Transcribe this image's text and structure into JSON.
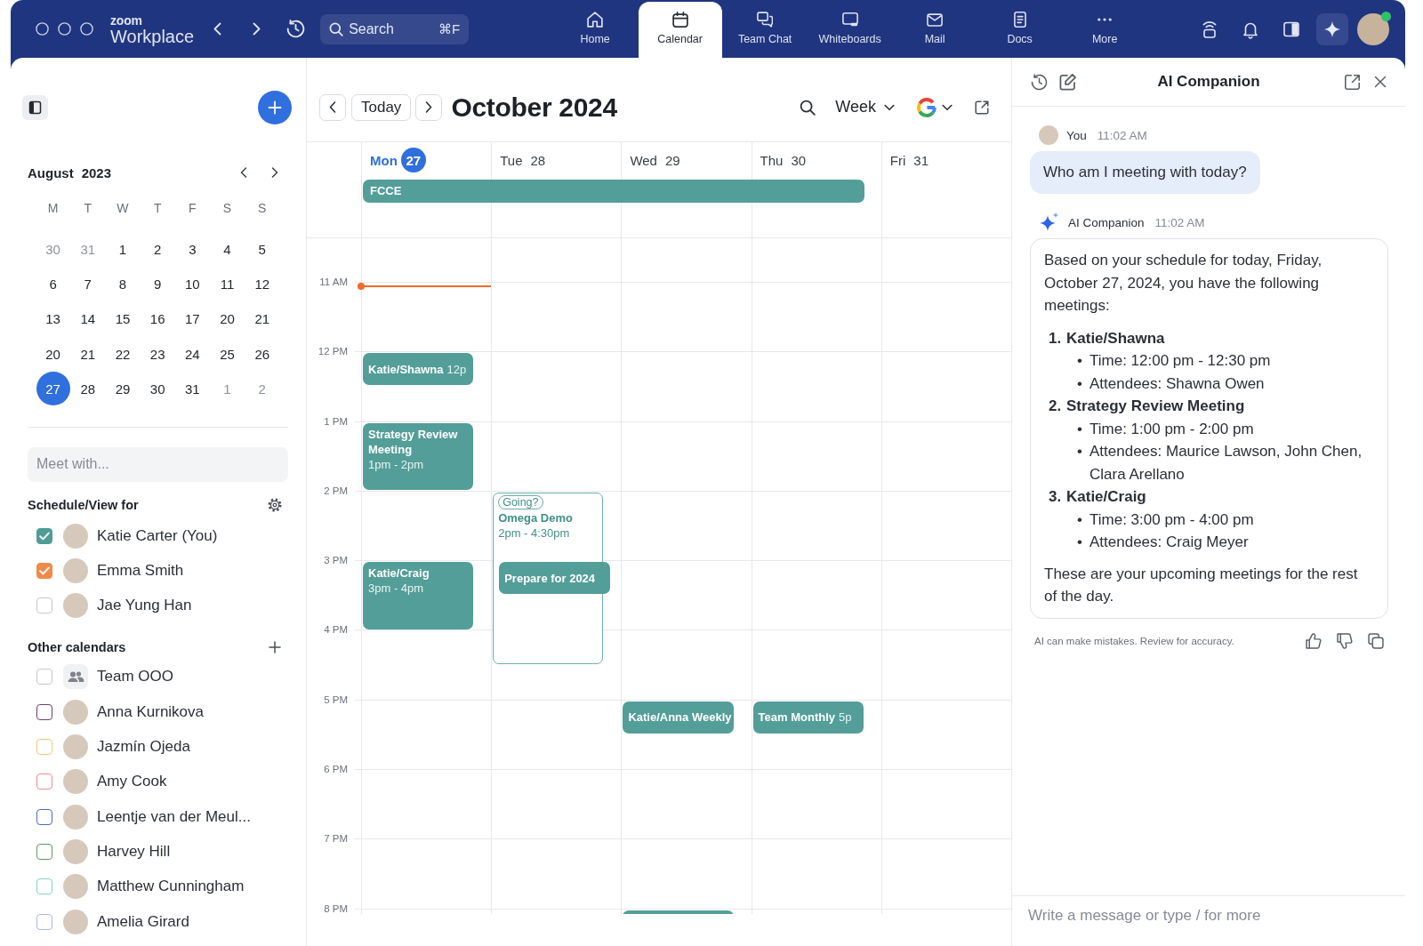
{
  "top_bar": {
    "logo_small": "zoom",
    "logo": "Workplace",
    "search": {
      "placeholder": "Search",
      "shortcut": "⌘F"
    },
    "nav": [
      {
        "label": "Home",
        "selected": false
      },
      {
        "label": "Calendar",
        "selected": true
      },
      {
        "label": "Team Chat",
        "selected": false
      },
      {
        "label": "Whiteboards",
        "selected": false
      },
      {
        "label": "Mail",
        "selected": false
      },
      {
        "label": "Docs",
        "selected": false
      },
      {
        "label": "More",
        "selected": false
      }
    ],
    "actions": [
      {
        "selected": false
      },
      {
        "selected": false
      },
      {
        "selected": false
      },
      {
        "selected": true
      }
    ],
    "user": {
      "online": true
    }
  },
  "sidebar": {
    "mini_calendar": {
      "month": "August",
      "year": "2023",
      "weekdays": [
        "M",
        "T",
        "W",
        "T",
        "F",
        "S",
        "S"
      ],
      "weeks": [
        [
          {
            "day": "30",
            "in_month": false,
            "selected": false
          },
          {
            "day": "31",
            "in_month": false,
            "selected": false
          },
          {
            "day": "1",
            "in_month": true,
            "selected": false
          },
          {
            "day": "2",
            "in_month": true,
            "selected": false
          },
          {
            "day": "3",
            "in_month": true,
            "selected": false
          },
          {
            "day": "4",
            "in_month": true,
            "selected": false
          },
          {
            "day": "5",
            "in_month": true,
            "selected": false
          }
        ],
        [
          {
            "day": "6",
            "in_month": true,
            "selected": false
          },
          {
            "day": "7",
            "in_month": true,
            "selected": false
          },
          {
            "day": "8",
            "in_month": true,
            "selected": false
          },
          {
            "day": "9",
            "in_month": true,
            "selected": false
          },
          {
            "day": "10",
            "in_month": true,
            "selected": false
          },
          {
            "day": "11",
            "in_month": true,
            "selected": false
          },
          {
            "day": "12",
            "in_month": true,
            "selected": false
          }
        ],
        [
          {
            "day": "13",
            "in_month": true,
            "selected": false
          },
          {
            "day": "14",
            "in_month": true,
            "selected": false
          },
          {
            "day": "15",
            "in_month": true,
            "selected": false
          },
          {
            "day": "16",
            "in_month": true,
            "selected": false
          },
          {
            "day": "17",
            "in_month": true,
            "selected": false
          },
          {
            "day": "20",
            "in_month": true,
            "selected": false
          },
          {
            "day": "21",
            "in_month": true,
            "selected": false
          }
        ],
        [
          {
            "day": "20",
            "in_month": true,
            "selected": false
          },
          {
            "day": "21",
            "in_month": true,
            "selected": false
          },
          {
            "day": "22",
            "in_month": true,
            "selected": false
          },
          {
            "day": "23",
            "in_month": true,
            "selected": false
          },
          {
            "day": "24",
            "in_month": true,
            "selected": false
          },
          {
            "day": "25",
            "in_month": true,
            "selected": false
          },
          {
            "day": "26",
            "in_month": true,
            "selected": false
          }
        ],
        [
          {
            "day": "27",
            "in_month": true,
            "selected": true
          },
          {
            "day": "28",
            "in_month": true,
            "selected": false
          },
          {
            "day": "29",
            "in_month": true,
            "selected": false
          },
          {
            "day": "30",
            "in_month": true,
            "selected": false
          },
          {
            "day": "31",
            "in_month": true,
            "selected": false
          },
          {
            "day": "1",
            "in_month": false,
            "selected": false
          },
          {
            "day": "2",
            "in_month": false,
            "selected": false
          }
        ]
      ]
    },
    "meet_with": {
      "placeholder": "Meet with..."
    },
    "schedule": {
      "title": "Schedule/View for",
      "people": [
        {
          "name": "Katie Carter (You)",
          "kind": "person",
          "checked": true,
          "color": "#4f9c96"
        },
        {
          "name": "Emma Smith",
          "kind": "person",
          "checked": true,
          "color": "#f08a4b"
        },
        {
          "name": "Jae Yung Han",
          "kind": "person",
          "checked": false,
          "color": "#c4c8cf"
        }
      ]
    },
    "other_calendars": {
      "title": "Other calendars",
      "items": [
        {
          "name": "Team OOO",
          "kind": "group",
          "checked": false,
          "color": "#c4c8cf"
        },
        {
          "name": "Anna Kurnikova",
          "kind": "person",
          "checked": false,
          "color": "#6e3f6e"
        },
        {
          "name": "Jazmín Ojeda",
          "kind": "person",
          "checked": false,
          "color": "#f4c87a"
        },
        {
          "name": "Amy Cook",
          "kind": "person",
          "checked": false,
          "color": "#e88e8e"
        },
        {
          "name": "Leentje van der Meul...",
          "kind": "person",
          "checked": false,
          "color": "#4a6cc2"
        },
        {
          "name": "Harvey Hill",
          "kind": "person",
          "checked": false,
          "color": "#5b9a5e"
        },
        {
          "name": "Matthew Cunningham",
          "kind": "person",
          "checked": false,
          "color": "#86cfc8"
        },
        {
          "name": "Amelia Girard",
          "kind": "person",
          "checked": false,
          "color": "#a8b8e8"
        }
      ]
    }
  },
  "calendar": {
    "today_button": "Today",
    "title": "October 2024",
    "view": "Week",
    "days": [
      {
        "weekday": "Mon",
        "date": "27",
        "today": true,
        "current_time": true,
        "events": [
          {
            "title": "Katie/Shawna",
            "time": "12p",
            "kind": "busy"
          },
          {
            "title": "Strategy Review Meeting",
            "time": "1pm - 2pm",
            "kind": "busy"
          },
          {
            "title": "Katie/Craig",
            "time": "3pm - 4pm",
            "kind": "busy"
          }
        ]
      },
      {
        "weekday": "Tue",
        "date": "28",
        "today": false,
        "events": [
          {
            "status": "Going?",
            "title": "Omega Demo",
            "time": "2pm - 4:30pm",
            "kind": "tentative"
          },
          {
            "title": "Prepare for 2024",
            "kind": "busy"
          }
        ]
      },
      {
        "weekday": "Wed",
        "date": "29",
        "today": false,
        "events": [
          {
            "title": "Katie/Anna Weekly",
            "kind": "busy"
          },
          {
            "kind": "busy"
          }
        ]
      },
      {
        "weekday": "Thu",
        "date": "30",
        "today": false,
        "events": [
          {
            "title": "Team Monthly",
            "time": "5p",
            "kind": "busy"
          }
        ]
      },
      {
        "weekday": "Fri",
        "date": "31",
        "today": false
      }
    ],
    "all_day": [
      {
        "title": "FCCE"
      }
    ],
    "hours": [
      "11 AM",
      "12 PM",
      "1 PM",
      "2 PM",
      "3 PM",
      "4 PM",
      "5 PM",
      "6 PM",
      "7 PM",
      "8 PM"
    ]
  },
  "ai_panel": {
    "title": "AI Companion",
    "messages": [
      {
        "kind": "user",
        "sender": "You",
        "time": "11:02 AM",
        "text": "Who am I meeting with today?"
      },
      {
        "kind": "assistant",
        "sender": "AI Companion",
        "time": "11:02 AM",
        "intro": "Based on your schedule for today, Friday, October 27, 2024, you have the following meetings:",
        "items": [
          {
            "number": "1.",
            "title": "Katie/Shawna",
            "bullets": [
              {
                "marker": "•",
                "text": "Time: 12:00 pm - 12:30 pm"
              },
              {
                "marker": "•",
                "text": "Attendees: Shawna Owen"
              }
            ]
          },
          {
            "number": "2.",
            "title": "Strategy Review Meeting",
            "bullets": [
              {
                "marker": "•",
                "text": "Time: 1:00 pm - 2:00 pm"
              },
              {
                "marker": "•",
                "text": "Attendees: Maurice Lawson, John Chen, Clara Arellano"
              }
            ]
          },
          {
            "number": "3.",
            "title": "Katie/Craig",
            "bullets": [
              {
                "marker": "•",
                "text": "Time: 3:00 pm - 4:00 pm"
              },
              {
                "marker": "•",
                "text": "Attendees: Craig Meyer"
              }
            ]
          }
        ],
        "outro": "These are your upcoming meetings for the rest of the day."
      }
    ],
    "disclaimer": "AI can make mistakes. Review for accuracy.",
    "composer": {
      "placeholder": "Write a message or type / for more"
    }
  }
}
